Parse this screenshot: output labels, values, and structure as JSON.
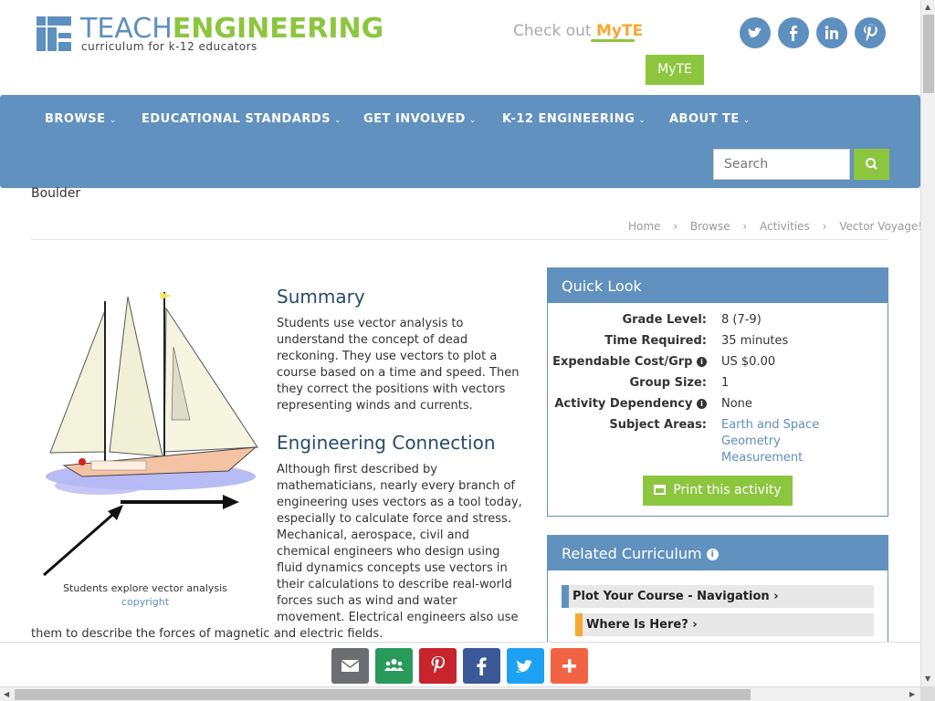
{
  "header": {
    "logo_teach": "TEACH",
    "logo_engineering": "ENGINEERING",
    "logo_sub": "curriculum for k-12 educators",
    "checkout_text": "Check out ",
    "checkout_brand": "MyTE",
    "myte_button": "MyTE",
    "social": [
      "twitter-icon",
      "facebook-icon",
      "linkedin-icon",
      "pinterest-icon"
    ]
  },
  "nav": {
    "items": [
      "BROWSE",
      "EDUCATIONAL STANDARDS",
      "GET INVOLVED",
      "K-12 ENGINEERING",
      "ABOUT TE"
    ],
    "search_placeholder": "Search"
  },
  "institution": "Boulder",
  "breadcrumb": [
    "Home",
    "Browse",
    "Activities",
    "Vector Voyage!"
  ],
  "image": {
    "caption": "Students explore vector analysis",
    "copyright": "copyright"
  },
  "summary": {
    "heading": "Summary",
    "text": "Students use vector analysis to understand the concept of dead reckoning. They use vectors to plot a course based on a time and speed. Then they correct the positions with vectors representing winds and currents."
  },
  "engineering": {
    "heading": "Engineering Connection",
    "text": "Although first described by mathematicians, nearly every branch of engineering uses vectors as a tool today, especially to calculate force and stress. Mechanical, aerospace, civil and chemical engineers who design using fluid dynamics concepts use vectors in their calculations to describe real-world forces such as wind and water movement. Electrical engineers also use",
    "text_tail": "them to describe the forces of magnetic and electric fields."
  },
  "quick_look": {
    "title": "Quick Look",
    "grade_label": "Grade Level:",
    "grade_value": "8 (7-9)",
    "time_label": "Time Required:",
    "time_value": "35 minutes",
    "cost_label": "Expendable Cost/Grp",
    "cost_value": "US $0.00",
    "group_label": "Group Size:",
    "group_value": "1",
    "dependency_label": "Activity Dependency",
    "dependency_value": "None",
    "subject_label": "Subject Areas:",
    "subjects": [
      "Earth and Space",
      "Geometry",
      "Measurement"
    ],
    "print_button": "Print this activity"
  },
  "related": {
    "title": "Related Curriculum",
    "items": [
      "Plot Your Course - Navigation",
      "Where Is Here?"
    ]
  },
  "share": [
    "email-icon",
    "group-icon",
    "pinterest-icon",
    "facebook-icon",
    "twitter-icon",
    "plus-icon"
  ],
  "colors": {
    "brand_blue": "#6191be",
    "brand_green": "#8cc63f",
    "heading_blue": "#264c6b",
    "share_email": "#6d6e71",
    "share_group": "#2a9a5b",
    "share_pinterest": "#c7242d",
    "share_facebook": "#3b5998",
    "share_twitter": "#1da1f2",
    "share_plus": "#f26344"
  }
}
